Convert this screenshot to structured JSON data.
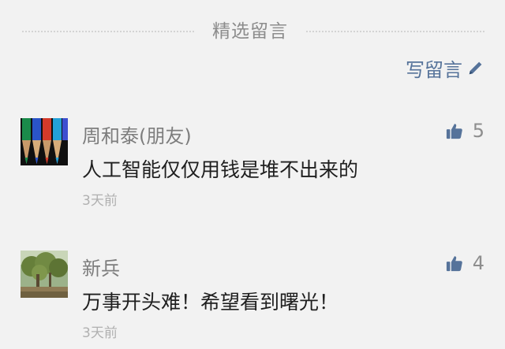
{
  "header": {
    "title": "精选留言",
    "write_label": "写留言"
  },
  "comments": [
    {
      "author": "周和泰(朋友)",
      "text": "人工智能仅仅用钱是堆不出来的",
      "time": "3天前",
      "likes": "5",
      "avatar_icon": "colored-pencils-avatar"
    },
    {
      "author": "新兵",
      "text": "万事开头难！希望看到曙光！",
      "time": "3天前",
      "likes": "4",
      "avatar_icon": "tree-landscape-avatar"
    }
  ],
  "colors": {
    "accent": "#56739a",
    "background": "#f2f2f2",
    "thumb": "#56739a"
  }
}
